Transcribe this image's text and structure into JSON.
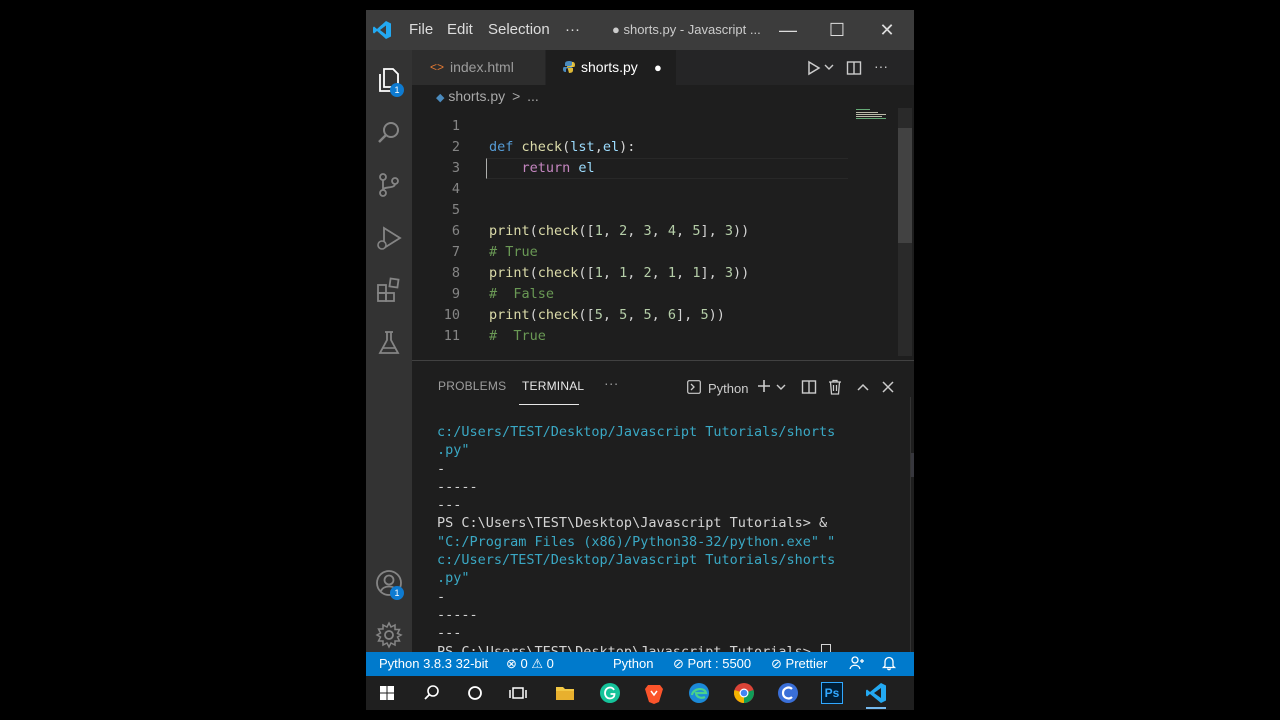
{
  "titlebar": {
    "menu": [
      "File",
      "Edit",
      "Selection",
      "···"
    ],
    "title": "● shorts.py - Javascript ...",
    "minimize": "—",
    "maximize": "☐",
    "close": "✕"
  },
  "activity_bar": {
    "explorer_badge": "1",
    "accounts_badge": "1",
    "icons": [
      "files-icon",
      "search-icon",
      "source-control-icon",
      "run-debug-icon",
      "extensions-icon",
      "testing-icon",
      "accounts-icon",
      "settings-gear-icon"
    ]
  },
  "tabs": [
    {
      "label": "index.html",
      "icon": "html-icon",
      "active": false
    },
    {
      "label": "shorts.py",
      "icon": "python-icon",
      "active": true,
      "modified": "●"
    }
  ],
  "breadcrumb": {
    "file": "shorts.py",
    "separator": ">",
    "more": "..."
  },
  "editor": {
    "lines": [
      {
        "n": "1",
        "tokens": []
      },
      {
        "n": "2",
        "tokens": [
          [
            "kw",
            "def "
          ],
          [
            "fn",
            "check"
          ],
          [
            "pun",
            "("
          ],
          [
            "var",
            "lst"
          ],
          [
            "pun",
            ","
          ],
          [
            "var",
            "el"
          ],
          [
            "pun",
            "):"
          ]
        ]
      },
      {
        "n": "3",
        "tokens": [
          [
            "pun",
            "    "
          ],
          [
            "kw2",
            "return "
          ],
          [
            "var",
            "el"
          ]
        ]
      },
      {
        "n": "4",
        "tokens": []
      },
      {
        "n": "5",
        "tokens": []
      },
      {
        "n": "6",
        "tokens": [
          [
            "fn",
            "print"
          ],
          [
            "pun",
            "("
          ],
          [
            "fn",
            "check"
          ],
          [
            "pun",
            "(["
          ],
          [
            "num",
            "1"
          ],
          [
            "pun",
            ", "
          ],
          [
            "num",
            "2"
          ],
          [
            "pun",
            ", "
          ],
          [
            "num",
            "3"
          ],
          [
            "pun",
            ", "
          ],
          [
            "num",
            "4"
          ],
          [
            "pun",
            ", "
          ],
          [
            "num",
            "5"
          ],
          [
            "pun",
            "], "
          ],
          [
            "num",
            "3"
          ],
          [
            "pun",
            "))"
          ]
        ]
      },
      {
        "n": "7",
        "tokens": [
          [
            "cmt",
            "# True"
          ]
        ]
      },
      {
        "n": "8",
        "tokens": [
          [
            "fn",
            "print"
          ],
          [
            "pun",
            "("
          ],
          [
            "fn",
            "check"
          ],
          [
            "pun",
            "(["
          ],
          [
            "num",
            "1"
          ],
          [
            "pun",
            ", "
          ],
          [
            "num",
            "1"
          ],
          [
            "pun",
            ", "
          ],
          [
            "num",
            "2"
          ],
          [
            "pun",
            ", "
          ],
          [
            "num",
            "1"
          ],
          [
            "pun",
            ", "
          ],
          [
            "num",
            "1"
          ],
          [
            "pun",
            "], "
          ],
          [
            "num",
            "3"
          ],
          [
            "pun",
            "))"
          ]
        ]
      },
      {
        "n": "9",
        "tokens": [
          [
            "cmt",
            "#  False"
          ]
        ]
      },
      {
        "n": "10",
        "tokens": [
          [
            "fn",
            "print"
          ],
          [
            "pun",
            "("
          ],
          [
            "fn",
            "check"
          ],
          [
            "pun",
            "(["
          ],
          [
            "num",
            "5"
          ],
          [
            "pun",
            ", "
          ],
          [
            "num",
            "5"
          ],
          [
            "pun",
            ", "
          ],
          [
            "num",
            "5"
          ],
          [
            "pun",
            ", "
          ],
          [
            "num",
            "6"
          ],
          [
            "pun",
            "], "
          ],
          [
            "num",
            "5"
          ],
          [
            "pun",
            "))"
          ]
        ]
      },
      {
        "n": "11",
        "tokens": [
          [
            "cmt",
            "#  True"
          ]
        ]
      }
    ]
  },
  "panel": {
    "tabs": [
      "PROBLEMS",
      "TERMINAL",
      "···"
    ],
    "shell_label": "Python",
    "terminal_lines": [
      {
        "cls": "t-cyan",
        "text": "c:/Users/TEST/Desktop/Javascript Tutorials/shorts"
      },
      {
        "cls": "t-cyan",
        "text": ".py\""
      },
      {
        "cls": "t-w",
        "text": "-"
      },
      {
        "cls": "t-w",
        "text": "-----"
      },
      {
        "cls": "t-w",
        "text": "---"
      },
      {
        "cls": "t-w",
        "text": "PS C:\\Users\\TEST\\Desktop\\Javascript Tutorials> &"
      },
      {
        "cls": "t-cyan",
        "text": "\"C:/Program Files (x86)/Python38-32/python.exe\" \""
      },
      {
        "cls": "t-cyan",
        "text": "c:/Users/TEST/Desktop/Javascript Tutorials/shorts"
      },
      {
        "cls": "t-cyan",
        "text": ".py\""
      },
      {
        "cls": "t-w",
        "text": "-"
      },
      {
        "cls": "t-w",
        "text": "-----"
      },
      {
        "cls": "t-w",
        "text": "---"
      }
    ],
    "prompt": "PS C:\\Users\\TEST\\Desktop\\Javascript Tutorials> "
  },
  "statusbar": {
    "interpreter": "Python 3.8.3 32-bit",
    "errors": "0",
    "warnings": "0",
    "language": "Python",
    "port": "Port : 5500",
    "prettier": "Prettier"
  },
  "taskbar": {
    "icons": [
      "windows-start-icon",
      "search-icon",
      "cortana-icon",
      "task-view-icon",
      "file-explorer-icon",
      "grammarly-icon",
      "brave-icon",
      "edge-icon",
      "chrome-icon",
      "edge-dev-icon",
      "photoshop-icon",
      "vscode-taskbar-icon"
    ],
    "photoshop_label": "Ps"
  },
  "colors": {
    "status_bar": "#007acc",
    "keyword": "#569cd6",
    "function": "#dcdcaa",
    "number": "#b5cea8",
    "comment": "#6a9955"
  }
}
